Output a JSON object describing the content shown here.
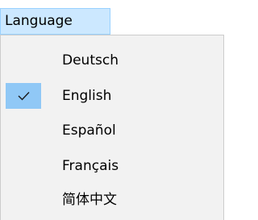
{
  "menubar": {
    "menu_label": "Language"
  },
  "language_menu": {
    "items": [
      {
        "label": "Deutsch",
        "checked": false
      },
      {
        "label": "English",
        "checked": true
      },
      {
        "label": "Español",
        "checked": false
      },
      {
        "label": "Français",
        "checked": false
      },
      {
        "label": "简体中文",
        "checked": false
      }
    ],
    "check_icon": "checkmark-icon"
  },
  "colors": {
    "menu_open_bg": "#cce8ff",
    "menu_open_border": "#99d1ff",
    "dropdown_bg": "#f2f2f2",
    "check_highlight": "#90c8f6"
  }
}
